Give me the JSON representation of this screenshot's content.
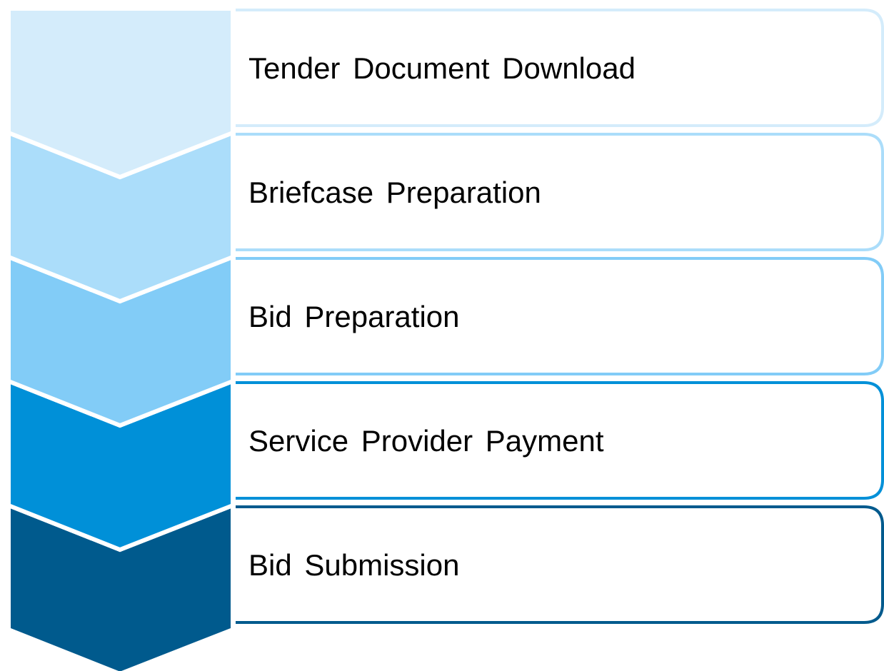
{
  "steps": [
    {
      "label": "Tender Document Download",
      "color": "#D4ECFB"
    },
    {
      "label": "Briefcase Preparation",
      "color": "#ABDDFA"
    },
    {
      "label": "Bid Preparation",
      "color": "#82CCF7"
    },
    {
      "label": "Service Provider Payment",
      "color": "#0090D8"
    },
    {
      "label": "Bid Submission",
      "color": "#005A8D"
    }
  ]
}
